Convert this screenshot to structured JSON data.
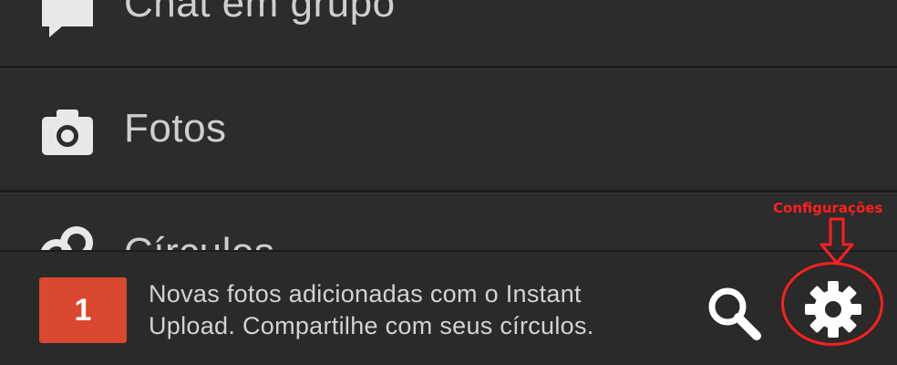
{
  "menu": {
    "items": [
      {
        "label": "Chat em grupo",
        "icon": "chat-bubble-icon"
      },
      {
        "label": "Fotos",
        "icon": "camera-icon"
      },
      {
        "label": "Círculos",
        "icon": "circles-icon"
      }
    ]
  },
  "notification": {
    "count": "1",
    "line1": "Novas fotos adicionadas com o Instant",
    "line2": "Upload. Compartilhe com seus círculos."
  },
  "toolbar": {
    "search_icon": "search-icon",
    "settings_icon": "gear-icon"
  },
  "annotation": {
    "label": "Configurações",
    "color": "#ff1f1f"
  },
  "colors": {
    "background": "#2b2b2b",
    "text": "#cfcfcf",
    "badge": "#d9482f"
  }
}
